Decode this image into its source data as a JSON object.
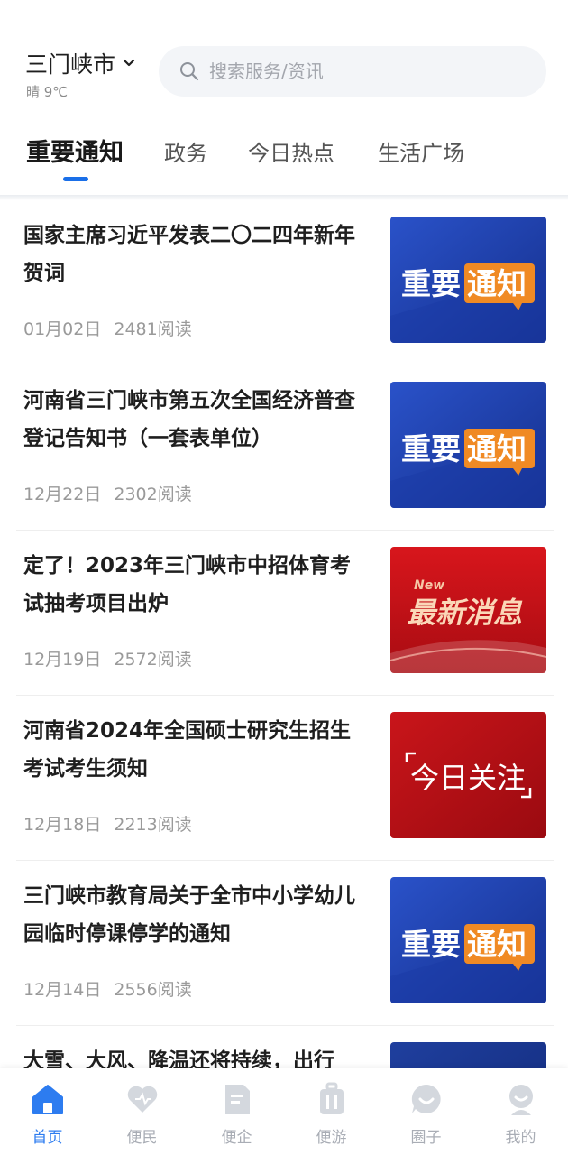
{
  "header": {
    "city": "三门峡市",
    "weather": "晴 9℃",
    "search_placeholder": "搜索服务/资讯"
  },
  "tabs": [
    {
      "label": "重要通知",
      "active": true
    },
    {
      "label": "政务",
      "active": false
    },
    {
      "label": "今日热点",
      "active": false
    },
    {
      "label": "生活广场",
      "active": false
    }
  ],
  "news": [
    {
      "title": "国家主席习近平发表二〇二四年新年贺词",
      "date": "01月02日",
      "reads": "2481阅读",
      "thumb": "important-notice"
    },
    {
      "title": "河南省三门峡市第五次全国经济普查登记告知书（一套表单位）",
      "date": "12月22日",
      "reads": "2302阅读",
      "thumb": "important-notice"
    },
    {
      "title": "定了！2023年三门峡市中招体育考试抽考项目出炉",
      "date": "12月19日",
      "reads": "2572阅读",
      "thumb": "latest-news"
    },
    {
      "title": "河南省2024年全国硕士研究生招生考试考生须知",
      "date": "12月18日",
      "reads": "2213阅读",
      "thumb": "today-focus"
    },
    {
      "title": "三门峡市教育局关于全市中小学幼儿园临时停课停学的通知",
      "date": "12月14日",
      "reads": "2556阅读",
      "thumb": "important-notice"
    },
    {
      "title": "大雪、大风、降温还将持续，出行",
      "date": "",
      "reads": "",
      "thumb": "important-notice"
    }
  ],
  "thumb_text": {
    "important_a": "重要",
    "important_b": "通知",
    "latest_small": "New",
    "latest": "最新消息",
    "today": "今日关注"
  },
  "tabbar": [
    {
      "label": "首页",
      "icon": "home-icon",
      "active": true
    },
    {
      "label": "便民",
      "icon": "heart-icon",
      "active": false
    },
    {
      "label": "便企",
      "icon": "document-icon",
      "active": false
    },
    {
      "label": "便游",
      "icon": "luggage-icon",
      "active": false
    },
    {
      "label": "圈子",
      "icon": "chat-smile-icon",
      "active": false
    },
    {
      "label": "我的",
      "icon": "user-icon",
      "active": false
    }
  ],
  "colors": {
    "accent": "#2d7cf0",
    "tab_inactive": "#a9adb5",
    "notice_blue": "#1b3fa8",
    "notice_orange": "#f08a24",
    "news_red": "#c8141a"
  }
}
